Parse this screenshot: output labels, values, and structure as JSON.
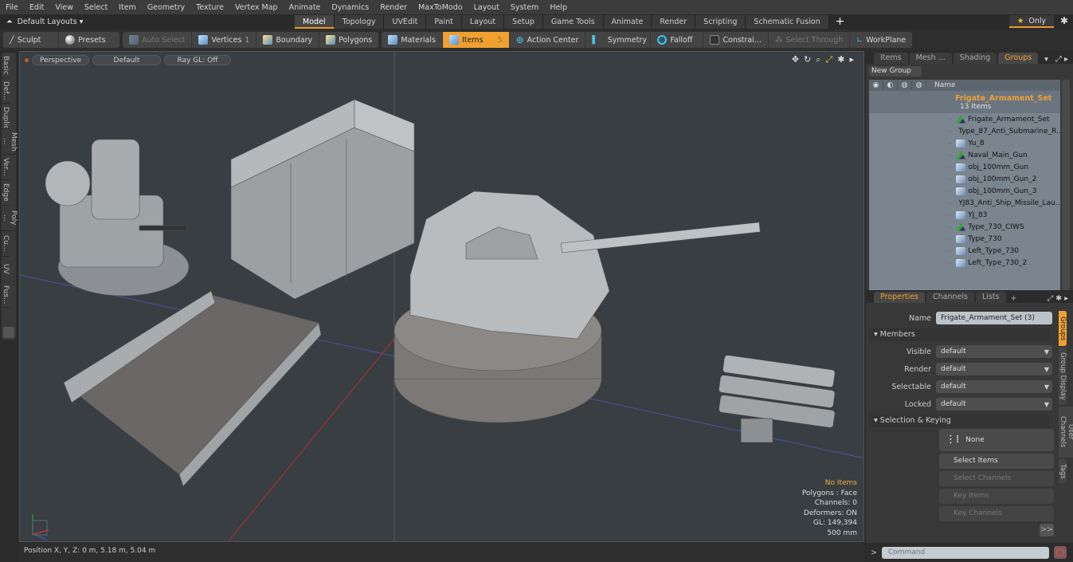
{
  "menu": [
    "File",
    "Edit",
    "View",
    "Select",
    "Item",
    "Geometry",
    "Texture",
    "Vertex Map",
    "Animate",
    "Dynamics",
    "Render",
    "MaxToModo",
    "Layout",
    "System",
    "Help"
  ],
  "layoutbar": {
    "layouts_label": "Default Layouts ▾",
    "tabs": [
      "Model",
      "Topology",
      "UVEdit",
      "Paint",
      "Layout",
      "Setup",
      "Game Tools",
      "Animate",
      "Render",
      "Scripting",
      "Schematic Fusion"
    ],
    "active_tab": "Model",
    "only_label": "Only"
  },
  "toolbar": {
    "sculpt": "Sculpt",
    "presets": "Presets",
    "auto_select": "Auto Select",
    "vertices": "Vertices",
    "vertices_count": "1",
    "boundary": "Boundary",
    "polygons": "Polygons",
    "materials": "Materials",
    "items": "Items",
    "items_count": "5",
    "action_center": "Action Center",
    "symmetry": "Symmetry",
    "falloff": "Falloff",
    "constraints": "Constrai...",
    "select_through": "Select Through",
    "workplane": "WorkPlane"
  },
  "left_tabs": [
    "Basic",
    "Def...",
    "Duplic...",
    "Mesh ...",
    "Ver...",
    "Edge",
    "Poly ...",
    "Cu...",
    "UV",
    "Fus..."
  ],
  "viewport": {
    "view": "Perspective",
    "shading": "Default",
    "raygl": "Ray GL: Off",
    "stats": {
      "items": "No Items",
      "polygons": "Polygons : Face",
      "channels": "Channels: 0",
      "deformers": "Deformers: ON",
      "gl": "GL: 149,394",
      "scale": "500 mm"
    }
  },
  "status": {
    "position": "Position X, Y, Z:   0 m, 5.18 m, 5.04 m"
  },
  "groups_panel": {
    "tabs": [
      "Items",
      "Mesh ...",
      "Shading",
      "Groups"
    ],
    "active_tab": "Groups",
    "new_group": "New Group",
    "column_name": "Name",
    "group": {
      "name": "Frigate_Armament_Set",
      "count": "13 Items"
    },
    "items": [
      {
        "name": "Frigate_Armament_Set",
        "type": "locator"
      },
      {
        "name": "Type_87_Anti_Submarine_R...",
        "type": "locator"
      },
      {
        "name": "Yu_8",
        "type": "mesh"
      },
      {
        "name": "Naval_Main_Gun",
        "type": "locator"
      },
      {
        "name": "obj_100mm_Gun",
        "type": "mesh"
      },
      {
        "name": "obj_100mm_Gun_2",
        "type": "mesh"
      },
      {
        "name": "obj_100mm_Gun_3",
        "type": "mesh"
      },
      {
        "name": "YJ83_Anti_Ship_Missile_Lau...",
        "type": "locator"
      },
      {
        "name": "YJ_83",
        "type": "mesh"
      },
      {
        "name": "Type_730_CIWS",
        "type": "locator"
      },
      {
        "name": "Type_730",
        "type": "mesh"
      },
      {
        "name": "Left_Type_730",
        "type": "mesh"
      },
      {
        "name": "Left_Type_730_2",
        "type": "mesh"
      }
    ]
  },
  "properties_panel": {
    "tabs": [
      "Properties",
      "Channels",
      "Lists"
    ],
    "active_tab": "Properties",
    "name_label": "Name",
    "name_value": "Frigate_Armament_Set (3)",
    "members_section": "Members",
    "fields": [
      {
        "label": "Visible",
        "value": "default"
      },
      {
        "label": "Render",
        "value": "default"
      },
      {
        "label": "Selectable",
        "value": "default"
      },
      {
        "label": "Locked",
        "value": "default"
      }
    ],
    "selection_section": "Selection & Keying",
    "none_button": "None",
    "select_items": "Select Items",
    "select_channels": "Select Channels",
    "key_items": "Key Items",
    "key_channels": "Key Channels",
    "more": ">>",
    "side_tabs": [
      "Groups",
      "Group Display",
      "User Channels",
      "Tags"
    ],
    "active_side_tab": "Groups"
  },
  "command": {
    "prompt": ">",
    "placeholder": "Command"
  },
  "colors": {
    "accent": "#f0a030",
    "viewport_bg": "#393e43"
  }
}
